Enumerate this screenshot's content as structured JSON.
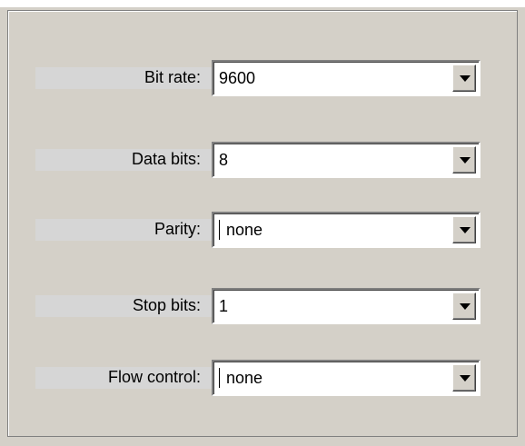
{
  "panel": {
    "fields": [
      {
        "label": "Bit rate:",
        "value": "9600"
      },
      {
        "label": "Data bits:",
        "value": "8"
      },
      {
        "label": "Parity:",
        "value": "none"
      },
      {
        "label": "Stop bits:",
        "value": "1"
      },
      {
        "label": "Flow control:",
        "value": "none"
      }
    ]
  },
  "icons": {
    "dropdown": "chevron-down-icon"
  }
}
